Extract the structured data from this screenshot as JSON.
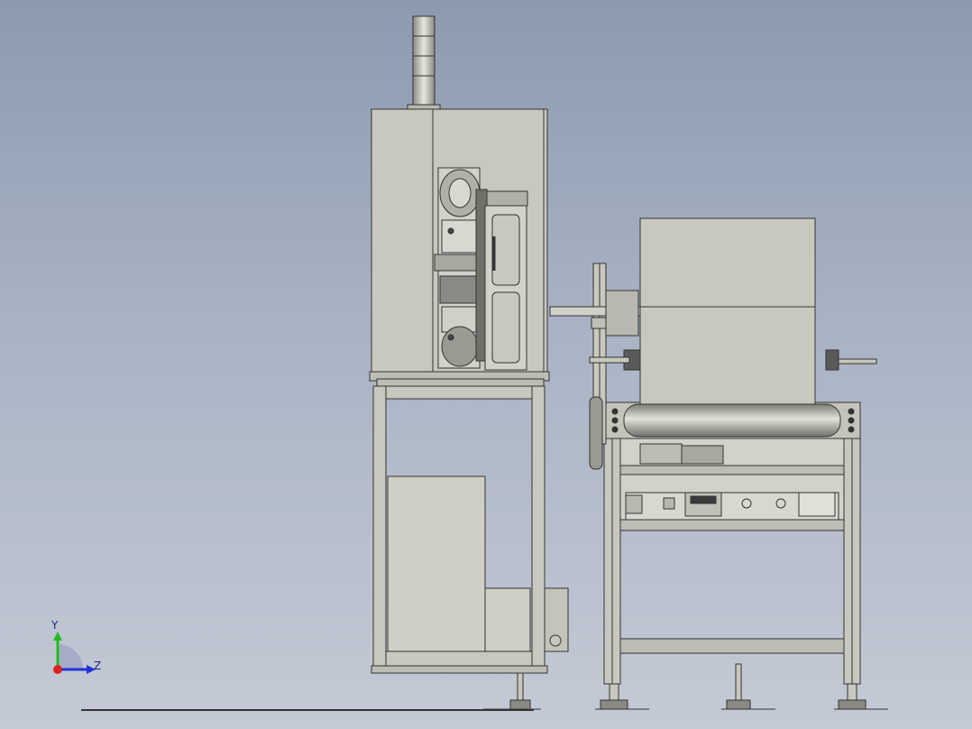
{
  "viewport": {
    "background_top": "#8c9ab0",
    "background_bottom": "#c4cad5",
    "part_fill": "#c8c8be",
    "part_dark": "#3a3a3a",
    "roller_fill": "#9a9a92"
  },
  "triad": {
    "y_label": "Y",
    "z_label": "Z",
    "y_color": "#22bb22",
    "z_color": "#2233dd",
    "x_color": "#dd2222"
  }
}
